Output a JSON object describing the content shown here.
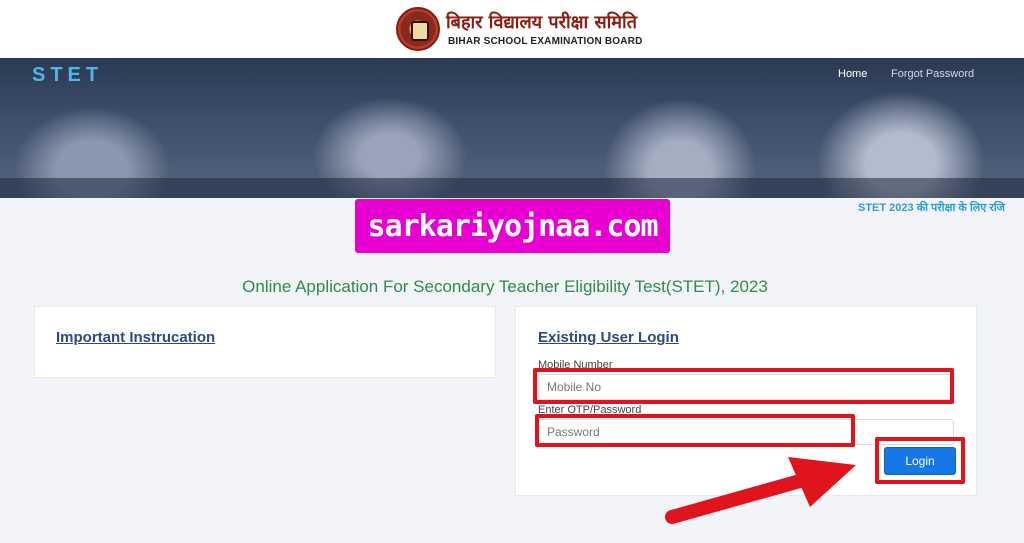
{
  "header": {
    "logo_hindi": "बिहार विद्यालय परीक्षा समिति",
    "logo_english": "BIHAR SCHOOL EXAMINATION BOARD",
    "logo_icon": "board-emblem-icon"
  },
  "navbar": {
    "brand": "STET",
    "home": "Home",
    "forgot_password": "Forgot Password"
  },
  "marquee": {
    "text": "STET 2023 की परीक्षा के लिए रजि"
  },
  "watermark": {
    "text": "sarkariyojnaa.com",
    "color": "#e800d2"
  },
  "main": {
    "title": "Online Application For Secondary Teacher Eligibility Test(STET), 2023",
    "instructions_title": "Important Instrucation",
    "login": {
      "title": "Existing User Login",
      "mobile_label": "Mobile Number",
      "mobile_placeholder": "Mobile No",
      "password_label": "Enter OTP/Password",
      "password_placeholder": "Password",
      "button_label": "Login"
    }
  },
  "colors": {
    "accent": "#1677e6",
    "highlight": "#e0141c",
    "title_green": "#2e8a57",
    "link_blue": "#2e4a7d"
  }
}
